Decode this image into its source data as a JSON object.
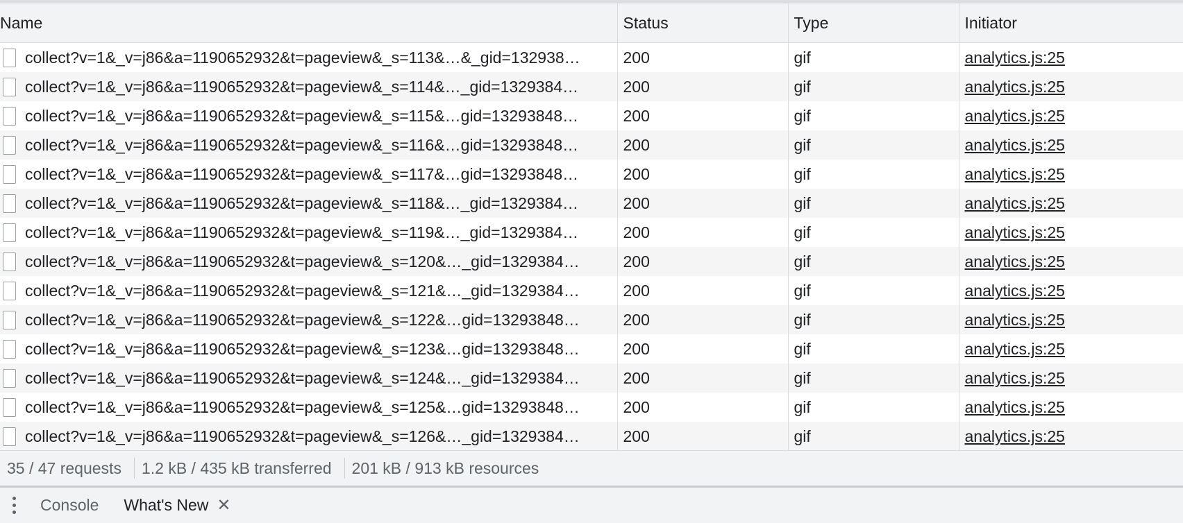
{
  "table": {
    "headers": {
      "name": "Name",
      "status": "Status",
      "type": "Type",
      "initiator": "Initiator"
    },
    "rows": [
      {
        "name": "collect?v=1&_v=j86&a=1190652932&t=pageview&_s=113&…&_gid=132938…",
        "status": "200",
        "type": "gif",
        "initiator": "analytics.js:25"
      },
      {
        "name": "collect?v=1&_v=j86&a=1190652932&t=pageview&_s=114&…_gid=1329384…",
        "status": "200",
        "type": "gif",
        "initiator": "analytics.js:25"
      },
      {
        "name": "collect?v=1&_v=j86&a=1190652932&t=pageview&_s=115&…gid=13293848…",
        "status": "200",
        "type": "gif",
        "initiator": "analytics.js:25"
      },
      {
        "name": "collect?v=1&_v=j86&a=1190652932&t=pageview&_s=116&…gid=13293848…",
        "status": "200",
        "type": "gif",
        "initiator": "analytics.js:25"
      },
      {
        "name": "collect?v=1&_v=j86&a=1190652932&t=pageview&_s=117&…gid=13293848…",
        "status": "200",
        "type": "gif",
        "initiator": "analytics.js:25"
      },
      {
        "name": "collect?v=1&_v=j86&a=1190652932&t=pageview&_s=118&…_gid=1329384…",
        "status": "200",
        "type": "gif",
        "initiator": "analytics.js:25"
      },
      {
        "name": "collect?v=1&_v=j86&a=1190652932&t=pageview&_s=119&…_gid=1329384…",
        "status": "200",
        "type": "gif",
        "initiator": "analytics.js:25"
      },
      {
        "name": "collect?v=1&_v=j86&a=1190652932&t=pageview&_s=120&…_gid=1329384…",
        "status": "200",
        "type": "gif",
        "initiator": "analytics.js:25"
      },
      {
        "name": "collect?v=1&_v=j86&a=1190652932&t=pageview&_s=121&…_gid=1329384…",
        "status": "200",
        "type": "gif",
        "initiator": "analytics.js:25"
      },
      {
        "name": "collect?v=1&_v=j86&a=1190652932&t=pageview&_s=122&…gid=13293848…",
        "status": "200",
        "type": "gif",
        "initiator": "analytics.js:25"
      },
      {
        "name": "collect?v=1&_v=j86&a=1190652932&t=pageview&_s=123&…gid=13293848…",
        "status": "200",
        "type": "gif",
        "initiator": "analytics.js:25"
      },
      {
        "name": "collect?v=1&_v=j86&a=1190652932&t=pageview&_s=124&…_gid=1329384…",
        "status": "200",
        "type": "gif",
        "initiator": "analytics.js:25"
      },
      {
        "name": "collect?v=1&_v=j86&a=1190652932&t=pageview&_s=125&…gid=13293848…",
        "status": "200",
        "type": "gif",
        "initiator": "analytics.js:25"
      },
      {
        "name": "collect?v=1&_v=j86&a=1190652932&t=pageview&_s=126&…_gid=1329384…",
        "status": "200",
        "type": "gif",
        "initiator": "analytics.js:25"
      }
    ]
  },
  "summary": {
    "requests": "35 / 47 requests",
    "transferred": "1.2 kB / 435 kB transferred",
    "resources": "201 kB / 913 kB resources"
  },
  "drawer": {
    "tabs": [
      {
        "label": "Console",
        "active": false
      },
      {
        "label": "What's New",
        "active": true,
        "closable": true
      }
    ],
    "close_glyph": "✕"
  },
  "colors": {
    "header_bg": "#f1f3f4",
    "row_stripe": "#f5f5f5",
    "border": "#dadce0",
    "muted_text": "#5f6368"
  }
}
